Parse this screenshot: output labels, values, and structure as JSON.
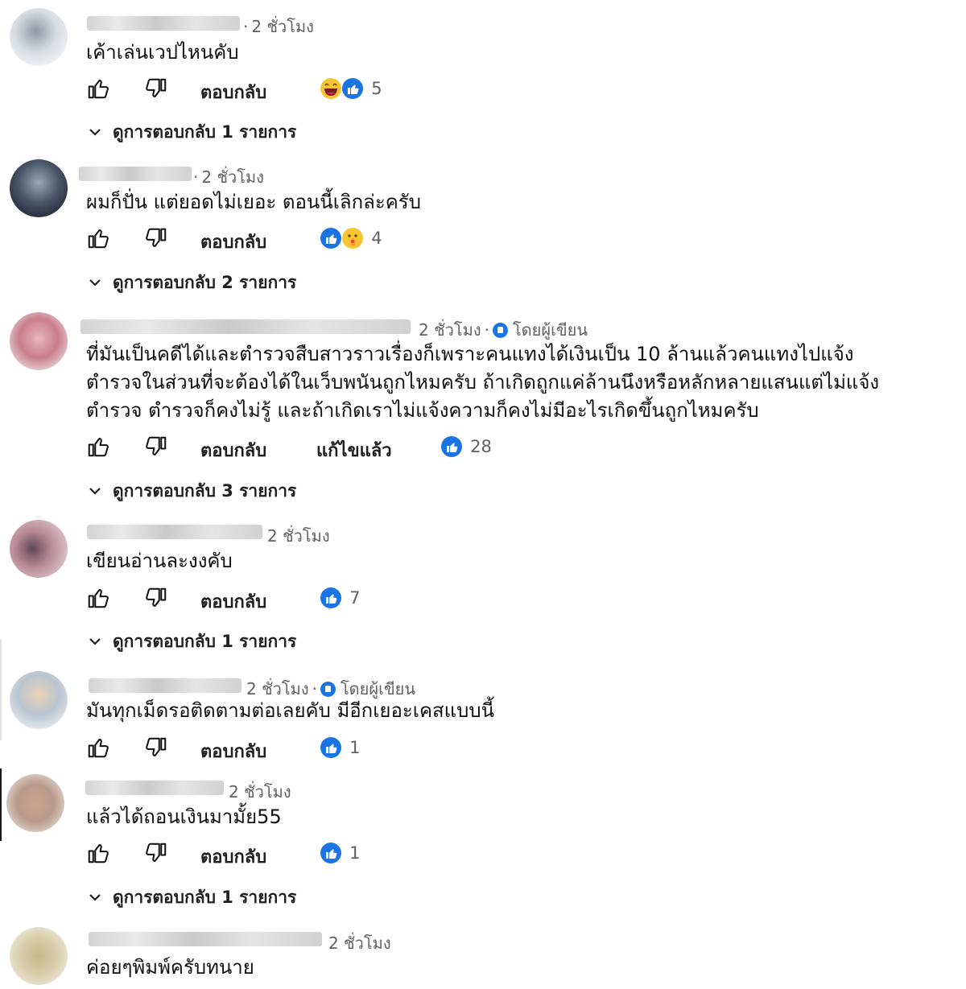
{
  "common": {
    "reply_label": "ตอบกลับ",
    "author_label": "โดยผู้เขียน",
    "edited_label": "แก้ไขแล้ว",
    "accent_color": "#1b74e4",
    "like_icon": "thumbs-up-icon",
    "dislike_icon": "thumbs-down-icon"
  },
  "comments": [
    {
      "time": "2 ชั่วโมง",
      "text": "เค้าเล่นเวปไหนคับ",
      "reactions": [
        "laughing-emoji-icon",
        "like-reaction-icon"
      ],
      "reaction_count": "5",
      "replies": "ดูการตอบกลับ 1 รายการ"
    },
    {
      "time": "2 ชั่วโมง",
      "text": "ผมก็ปั่น แต่ยอดไม่เยอะ ตอนนี้เลิกล่ะครับ",
      "reactions": [
        "like-reaction-icon",
        "shushing-emoji-icon"
      ],
      "reaction_count": "4",
      "replies": "ดูการตอบกลับ 2 รายการ"
    },
    {
      "time": "2 ชั่วโมง",
      "by_author": true,
      "text_lines": [
        "ที่มันเป็นคดีได้และตำรวจสืบสาวราวเรื่องก็เพราะคนแทงได้เงินเป็น 10 ล้านแล้วคนแทงไปแจ้ง",
        "ตำรวจในส่วนที่จะต้องได้ในเว็บพนันถูกไหมครับ ถ้าเกิดถูกแค่ล้านนึงหรือหลักหลายแสนแต่ไม่แจ้ง",
        "ตำรวจ ตำรวจก็คงไม่รู้ และถ้าเกิดเราไม่แจ้งความก็คงไม่มีอะไรเกิดขึ้นถูกไหมครับ"
      ],
      "edited": true,
      "reactions": [
        "like-reaction-icon"
      ],
      "reaction_count": "28",
      "replies": "ดูการตอบกลับ 3 รายการ"
    },
    {
      "time": "2 ชั่วโมง",
      "text": "เขียนอ่านละงงคับ",
      "reactions": [
        "like-reaction-icon"
      ],
      "reaction_count": "7",
      "replies": "ดูการตอบกลับ 1 รายการ"
    },
    {
      "time": "2 ชั่วโมง",
      "by_author": true,
      "text": "มันทุกเม็ดรอติดตามต่อเลยคับ มีอีกเยอะเคสแบบนี้",
      "reactions": [
        "like-reaction-icon"
      ],
      "reaction_count": "1"
    },
    {
      "time": "2 ชั่วโมง",
      "text": "แล้วได้ถอนเงินมามั้ย55",
      "reactions": [
        "like-reaction-icon"
      ],
      "reaction_count": "1",
      "replies": "ดูการตอบกลับ 1 รายการ"
    },
    {
      "time": "2 ชั่วโมง",
      "text": "ค่อยๆพิมพ์ครับทนาย"
    }
  ]
}
